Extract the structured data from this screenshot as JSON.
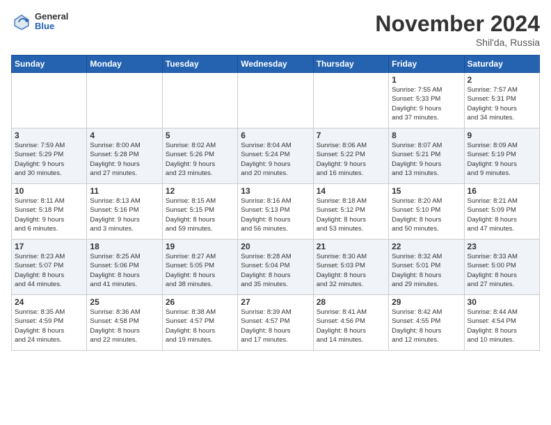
{
  "header": {
    "logo_general": "General",
    "logo_blue": "Blue",
    "month": "November 2024",
    "location": "Shil'da, Russia"
  },
  "days_of_week": [
    "Sunday",
    "Monday",
    "Tuesday",
    "Wednesday",
    "Thursday",
    "Friday",
    "Saturday"
  ],
  "weeks": [
    [
      {
        "day": "",
        "info": ""
      },
      {
        "day": "",
        "info": ""
      },
      {
        "day": "",
        "info": ""
      },
      {
        "day": "",
        "info": ""
      },
      {
        "day": "",
        "info": ""
      },
      {
        "day": "1",
        "info": "Sunrise: 7:55 AM\nSunset: 5:33 PM\nDaylight: 9 hours\nand 37 minutes."
      },
      {
        "day": "2",
        "info": "Sunrise: 7:57 AM\nSunset: 5:31 PM\nDaylight: 9 hours\nand 34 minutes."
      }
    ],
    [
      {
        "day": "3",
        "info": "Sunrise: 7:59 AM\nSunset: 5:29 PM\nDaylight: 9 hours\nand 30 minutes."
      },
      {
        "day": "4",
        "info": "Sunrise: 8:00 AM\nSunset: 5:28 PM\nDaylight: 9 hours\nand 27 minutes."
      },
      {
        "day": "5",
        "info": "Sunrise: 8:02 AM\nSunset: 5:26 PM\nDaylight: 9 hours\nand 23 minutes."
      },
      {
        "day": "6",
        "info": "Sunrise: 8:04 AM\nSunset: 5:24 PM\nDaylight: 9 hours\nand 20 minutes."
      },
      {
        "day": "7",
        "info": "Sunrise: 8:06 AM\nSunset: 5:22 PM\nDaylight: 9 hours\nand 16 minutes."
      },
      {
        "day": "8",
        "info": "Sunrise: 8:07 AM\nSunset: 5:21 PM\nDaylight: 9 hours\nand 13 minutes."
      },
      {
        "day": "9",
        "info": "Sunrise: 8:09 AM\nSunset: 5:19 PM\nDaylight: 9 hours\nand 9 minutes."
      }
    ],
    [
      {
        "day": "10",
        "info": "Sunrise: 8:11 AM\nSunset: 5:18 PM\nDaylight: 9 hours\nand 6 minutes."
      },
      {
        "day": "11",
        "info": "Sunrise: 8:13 AM\nSunset: 5:16 PM\nDaylight: 9 hours\nand 3 minutes."
      },
      {
        "day": "12",
        "info": "Sunrise: 8:15 AM\nSunset: 5:15 PM\nDaylight: 8 hours\nand 59 minutes."
      },
      {
        "day": "13",
        "info": "Sunrise: 8:16 AM\nSunset: 5:13 PM\nDaylight: 8 hours\nand 56 minutes."
      },
      {
        "day": "14",
        "info": "Sunrise: 8:18 AM\nSunset: 5:12 PM\nDaylight: 8 hours\nand 53 minutes."
      },
      {
        "day": "15",
        "info": "Sunrise: 8:20 AM\nSunset: 5:10 PM\nDaylight: 8 hours\nand 50 minutes."
      },
      {
        "day": "16",
        "info": "Sunrise: 8:21 AM\nSunset: 5:09 PM\nDaylight: 8 hours\nand 47 minutes."
      }
    ],
    [
      {
        "day": "17",
        "info": "Sunrise: 8:23 AM\nSunset: 5:07 PM\nDaylight: 8 hours\nand 44 minutes."
      },
      {
        "day": "18",
        "info": "Sunrise: 8:25 AM\nSunset: 5:06 PM\nDaylight: 8 hours\nand 41 minutes."
      },
      {
        "day": "19",
        "info": "Sunrise: 8:27 AM\nSunset: 5:05 PM\nDaylight: 8 hours\nand 38 minutes."
      },
      {
        "day": "20",
        "info": "Sunrise: 8:28 AM\nSunset: 5:04 PM\nDaylight: 8 hours\nand 35 minutes."
      },
      {
        "day": "21",
        "info": "Sunrise: 8:30 AM\nSunset: 5:03 PM\nDaylight: 8 hours\nand 32 minutes."
      },
      {
        "day": "22",
        "info": "Sunrise: 8:32 AM\nSunset: 5:01 PM\nDaylight: 8 hours\nand 29 minutes."
      },
      {
        "day": "23",
        "info": "Sunrise: 8:33 AM\nSunset: 5:00 PM\nDaylight: 8 hours\nand 27 minutes."
      }
    ],
    [
      {
        "day": "24",
        "info": "Sunrise: 8:35 AM\nSunset: 4:59 PM\nDaylight: 8 hours\nand 24 minutes."
      },
      {
        "day": "25",
        "info": "Sunrise: 8:36 AM\nSunset: 4:58 PM\nDaylight: 8 hours\nand 22 minutes."
      },
      {
        "day": "26",
        "info": "Sunrise: 8:38 AM\nSunset: 4:57 PM\nDaylight: 8 hours\nand 19 minutes."
      },
      {
        "day": "27",
        "info": "Sunrise: 8:39 AM\nSunset: 4:57 PM\nDaylight: 8 hours\nand 17 minutes."
      },
      {
        "day": "28",
        "info": "Sunrise: 8:41 AM\nSunset: 4:56 PM\nDaylight: 8 hours\nand 14 minutes."
      },
      {
        "day": "29",
        "info": "Sunrise: 8:42 AM\nSunset: 4:55 PM\nDaylight: 8 hours\nand 12 minutes."
      },
      {
        "day": "30",
        "info": "Sunrise: 8:44 AM\nSunset: 4:54 PM\nDaylight: 8 hours\nand 10 minutes."
      }
    ]
  ]
}
